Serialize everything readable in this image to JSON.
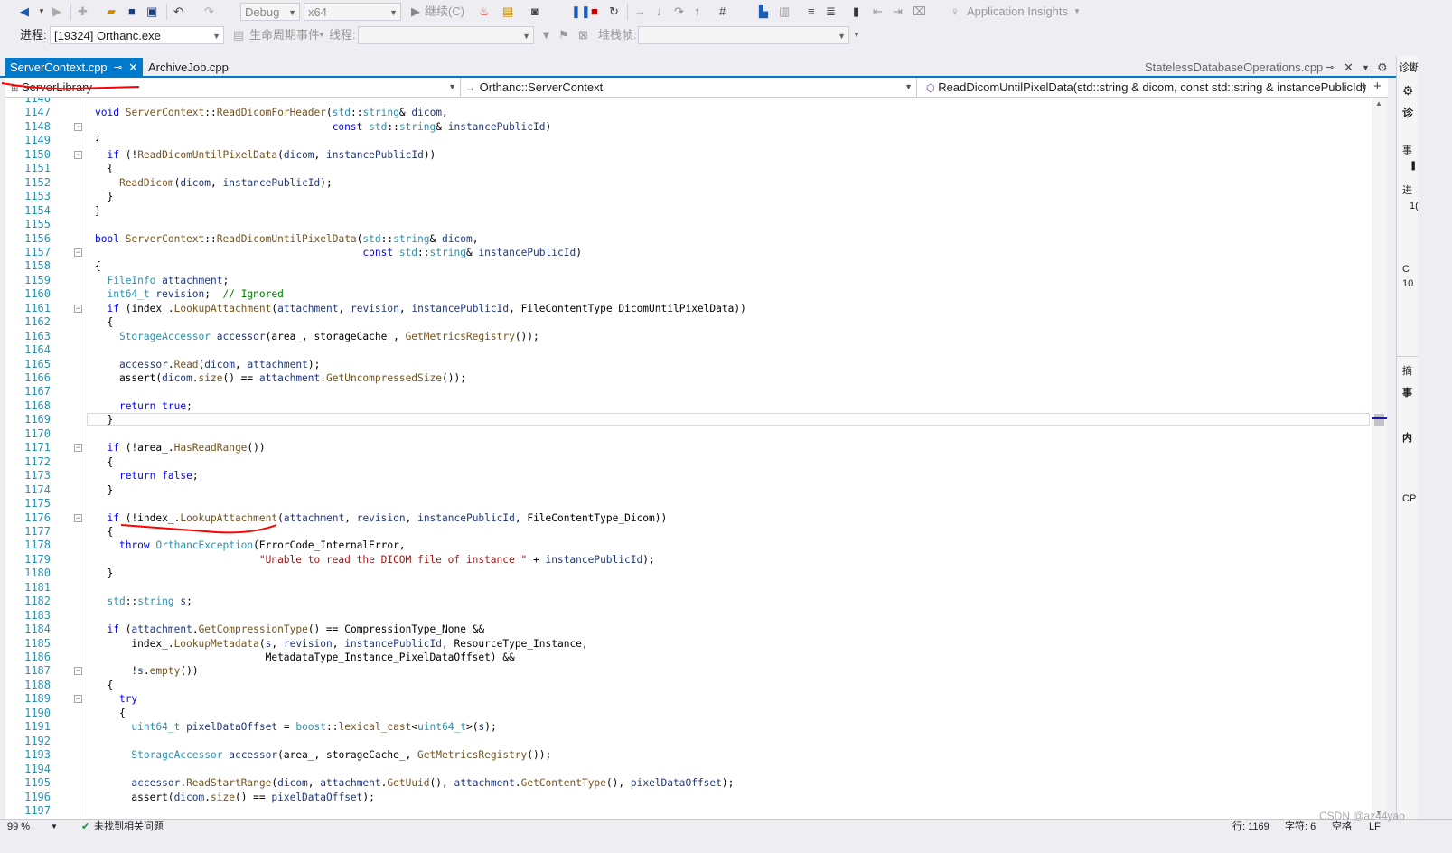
{
  "toolbar": {
    "config": "Debug",
    "platform": "x64",
    "continue_label": "继续(C)",
    "app_insights": "Application Insights"
  },
  "toolbar2": {
    "process_label": "进程:",
    "process_value": "[19324] Orthanc.exe",
    "lifecycle_label": "生命周期事件",
    "thread_label": "线程:",
    "stackframe_label": "堆栈帧:"
  },
  "tabs": [
    {
      "label": "ServerContext.cpp",
      "active": true
    },
    {
      "label": "ArchiveJob.cpp",
      "active": false
    }
  ],
  "preview_tab": "StatelessDatabaseOperations.cpp",
  "nav": {
    "project": "ServerLibrary",
    "scope": "Orthanc::ServerContext",
    "member": "ReadDicomUntilPixelData(std::string & dicom, const std::string & instancePublicId)"
  },
  "code_lines": [
    {
      "n": "1146",
      "code": ""
    },
    {
      "n": "1147",
      "code": "void ServerContext::ReadDicomForHeader(std::string& dicom,"
    },
    {
      "n": "1148",
      "code": "                                       const std::string& instancePublicId)"
    },
    {
      "n": "1149",
      "code": "{"
    },
    {
      "n": "1150",
      "code": "  if (!ReadDicomUntilPixelData(dicom, instancePublicId))"
    },
    {
      "n": "1151",
      "code": "  {"
    },
    {
      "n": "1152",
      "code": "    ReadDicom(dicom, instancePublicId);"
    },
    {
      "n": "1153",
      "code": "  }"
    },
    {
      "n": "1154",
      "code": "}"
    },
    {
      "n": "1155",
      "code": ""
    },
    {
      "n": "1156",
      "code": "bool ServerContext::ReadDicomUntilPixelData(std::string& dicom,"
    },
    {
      "n": "1157",
      "code": "                                            const std::string& instancePublicId)"
    },
    {
      "n": "1158",
      "code": "{"
    },
    {
      "n": "1159",
      "code": "  FileInfo attachment;"
    },
    {
      "n": "1160",
      "code": "  int64_t revision;  // Ignored"
    },
    {
      "n": "1161",
      "code": "  if (index_.LookupAttachment(attachment, revision, instancePublicId, FileContentType_DicomUntilPixelData))"
    },
    {
      "n": "1162",
      "code": "  {"
    },
    {
      "n": "1163",
      "code": "    StorageAccessor accessor(area_, storageCache_, GetMetricsRegistry());"
    },
    {
      "n": "1164",
      "code": ""
    },
    {
      "n": "1165",
      "code": "    accessor.Read(dicom, attachment);"
    },
    {
      "n": "1166",
      "code": "    assert(dicom.size() == attachment.GetUncompressedSize());"
    },
    {
      "n": "1167",
      "code": ""
    },
    {
      "n": "1168",
      "code": "    return true;"
    },
    {
      "n": "1169",
      "code": "  }"
    },
    {
      "n": "1170",
      "code": ""
    },
    {
      "n": "1171",
      "code": "  if (!area_.HasReadRange())"
    },
    {
      "n": "1172",
      "code": "  {"
    },
    {
      "n": "1173",
      "code": "    return false;"
    },
    {
      "n": "1174",
      "code": "  }"
    },
    {
      "n": "1175",
      "code": ""
    },
    {
      "n": "1176",
      "code": "  if (!index_.LookupAttachment(attachment, revision, instancePublicId, FileContentType_Dicom))"
    },
    {
      "n": "1177",
      "code": "  {"
    },
    {
      "n": "1178",
      "code": "    throw OrthancException(ErrorCode_InternalError,"
    },
    {
      "n": "1179",
      "code": "                           \"Unable to read the DICOM file of instance \" + instancePublicId);"
    },
    {
      "n": "1180",
      "code": "  }"
    },
    {
      "n": "1181",
      "code": ""
    },
    {
      "n": "1182",
      "code": "  std::string s;"
    },
    {
      "n": "1183",
      "code": ""
    },
    {
      "n": "1184",
      "code": "  if (attachment.GetCompressionType() == CompressionType_None &&"
    },
    {
      "n": "1185",
      "code": "      index_.LookupMetadata(s, revision, instancePublicId, ResourceType_Instance,"
    },
    {
      "n": "1186",
      "code": "                            MetadataType_Instance_PixelDataOffset) &&"
    },
    {
      "n": "1187",
      "code": "      !s.empty())"
    },
    {
      "n": "1188",
      "code": "  {"
    },
    {
      "n": "1189",
      "code": "    try"
    },
    {
      "n": "1190",
      "code": "    {"
    },
    {
      "n": "1191",
      "code": "      uint64_t pixelDataOffset = boost::lexical_cast<uint64_t>(s);"
    },
    {
      "n": "1192",
      "code": ""
    },
    {
      "n": "1193",
      "code": "      StorageAccessor accessor(area_, storageCache_, GetMetricsRegistry());"
    },
    {
      "n": "1194",
      "code": ""
    },
    {
      "n": "1195",
      "code": "      accessor.ReadStartRange(dicom, attachment.GetUuid(), attachment.GetContentType(), pixelDataOffset);"
    },
    {
      "n": "1196",
      "code": "      assert(dicom.size() == pixelDataOffset);"
    },
    {
      "n": "1197",
      "code": ""
    }
  ],
  "right_panel": [
    "诊断",
    "诊",
    "事",
    "进",
    "1(",
    "C",
    "10",
    "摘",
    "事",
    "内",
    "CP"
  ],
  "status": {
    "zoom": "99 %",
    "issues": "未找到相关问题",
    "line": "行: 1169",
    "char": "字符: 6",
    "spaces": "空格",
    "eol": "LF"
  },
  "watermark": "CSDN @az44yao",
  "colors": {
    "accent": "#007acc",
    "keyword": "#0000ff",
    "type": "#2b91af",
    "function": "#74531f",
    "string": "#a31515",
    "comment": "#008000",
    "annotation": "#ff0000"
  }
}
